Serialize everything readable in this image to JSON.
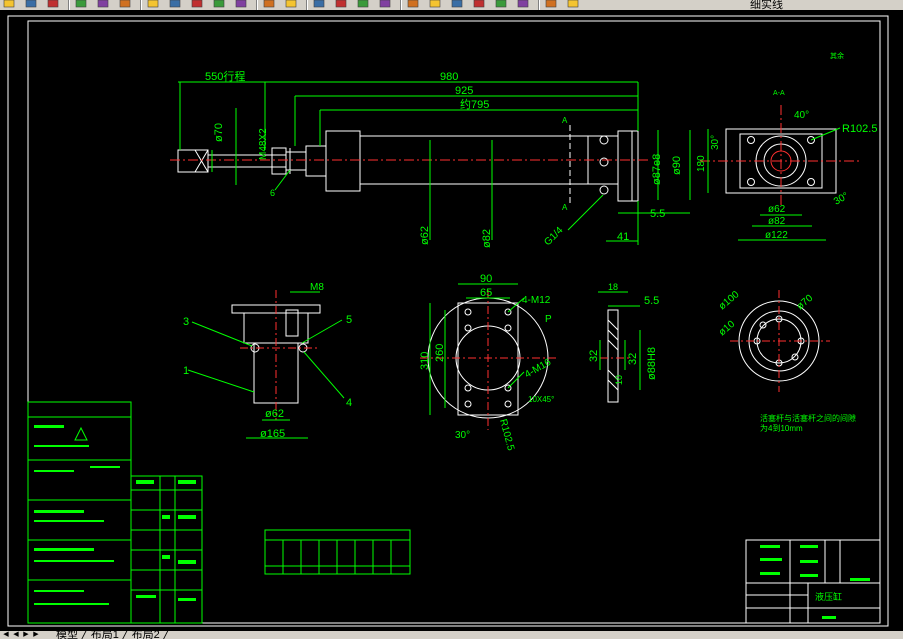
{
  "toolbar": {
    "layer_name": "细实线",
    "buttons": [
      "open-icon",
      "save-icon",
      "plot-icon",
      "preview-icon",
      "publish-icon",
      "check-icon",
      "cut-icon",
      "copy-icon",
      "paste-icon",
      "match-icon",
      "brush-icon",
      "undo-icon",
      "redo-icon",
      "pan-icon",
      "zoom-realtime-icon",
      "zoom-window-icon",
      "zoom-previous-icon",
      "properties-icon",
      "design-center-icon",
      "tool-palette-icon",
      "sheetset-icon",
      "markup-icon",
      "calculator-icon",
      "layer-manager-icon",
      "layer-state-icon"
    ]
  },
  "statusbar": {
    "tabs_text": "模型 ╱ 布局1 ╱ 布局2 ╱"
  },
  "drawing": {
    "colors": {
      "outline": "#ffffff",
      "dim": "#00ff00",
      "center": "#ff3030",
      "text": "#00ff00"
    },
    "main_view": {
      "dims": {
        "stroke": "550行程",
        "total": "980",
        "d925": "925",
        "d795": "约795",
        "rod": "ø70",
        "thread": "M48X2",
        "d62": "ø62",
        "d82": "ø82",
        "d87": "ø87e8",
        "d90": "ø90",
        "d5": "5.5",
        "d41": "41",
        "g1": "G1/4",
        "part6": "6",
        "sec_a": "A",
        "sec_a2": "A"
      }
    },
    "section_view": {
      "title": "A-A",
      "d40": "40°",
      "d30": "30°",
      "r": "R102.5",
      "d180": "180",
      "d62": "ø62",
      "d82": "ø82",
      "d122": "ø122",
      "d30b": "30°"
    },
    "mount_view": {
      "m8": "M8",
      "n1": "1",
      "n3": "3",
      "n4": "4",
      "n5": "5",
      "d62": "ø62",
      "d165": "ø165"
    },
    "flange_view": {
      "d90": "90",
      "d65": "65",
      "m12": "4-M12",
      "m16": "4-M16",
      "p": "P",
      "d310": "310",
      "d260": "260",
      "chamfer": "10X45°",
      "r": "R102.5",
      "a30": "30°"
    },
    "plate_view": {
      "d18": "18",
      "d55": "5.5",
      "d32": "32",
      "d32b": "32",
      "d10": "10",
      "d88": "ø88H8"
    },
    "round_view": {
      "d100": "ø100",
      "d70": "ø70",
      "d10": "ø10"
    },
    "tech_note": {
      "line1": "活塞杆与活塞杆之间的间隙",
      "line2": "为4到10mm"
    },
    "corner_mark": "其余",
    "title_block_name": "液压缸"
  }
}
